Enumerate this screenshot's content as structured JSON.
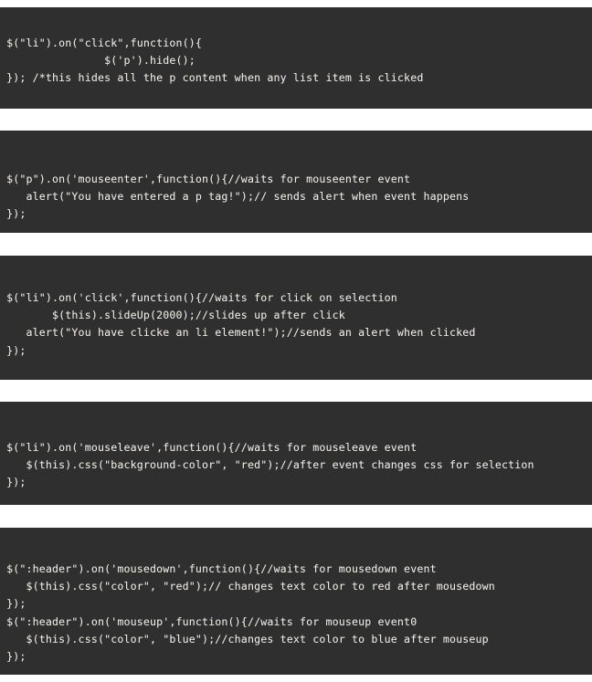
{
  "page": {
    "title": "jQuery event handler code snippets",
    "background_color": "#ffffff",
    "code_background_color": "#2f2f2f",
    "code_text_color": "#f2f0eb"
  },
  "blocks": [
    {
      "id": "block-0",
      "name": "code-block-click-hide",
      "lines": [
        " $(\"li\").on(\"click\",function(){",
        "                $('p').hide();",
        " }); /*this hides all the p content when any list item is clicked"
      ]
    },
    {
      "id": "block-1",
      "name": "code-block-mouseenter-alert",
      "lines": [
        " $(\"p\").on('mouseenter',function(){//waits for mouseenter event",
        "    alert(\"You have entered a p tag!\");// sends alert when event happens",
        " });"
      ]
    },
    {
      "id": "block-2",
      "name": "code-block-click-slideup",
      "lines": [
        " $(\"li\").on('click',function(){//waits for click on selection",
        "        $(this).slideUp(2000);//slides up after click",
        "    alert(\"You have clicke an li element!\");//sends an alert when clicked",
        " });"
      ]
    },
    {
      "id": "block-3",
      "name": "code-block-mouseleave-css",
      "lines": [
        " $(\"li\").on('mouseleave',function(){//waits for mouseleave event",
        "    $(this).css(\"background-color\", \"red\");//after event changes css for selection",
        " });"
      ]
    },
    {
      "id": "block-4",
      "name": "code-block-mousedown-mouseup",
      "lines": [
        " $(\":header\").on('mousedown',function(){//waits for mousedown event",
        "    $(this).css(\"color\", \"red\");// changes text color to red after mousedown",
        " });",
        " $(\":header\").on('mouseup',function(){//waits for mouseup event0",
        "    $(this).css(\"color\", \"blue\");//changes text color to blue after mouseup",
        " });"
      ]
    }
  ]
}
